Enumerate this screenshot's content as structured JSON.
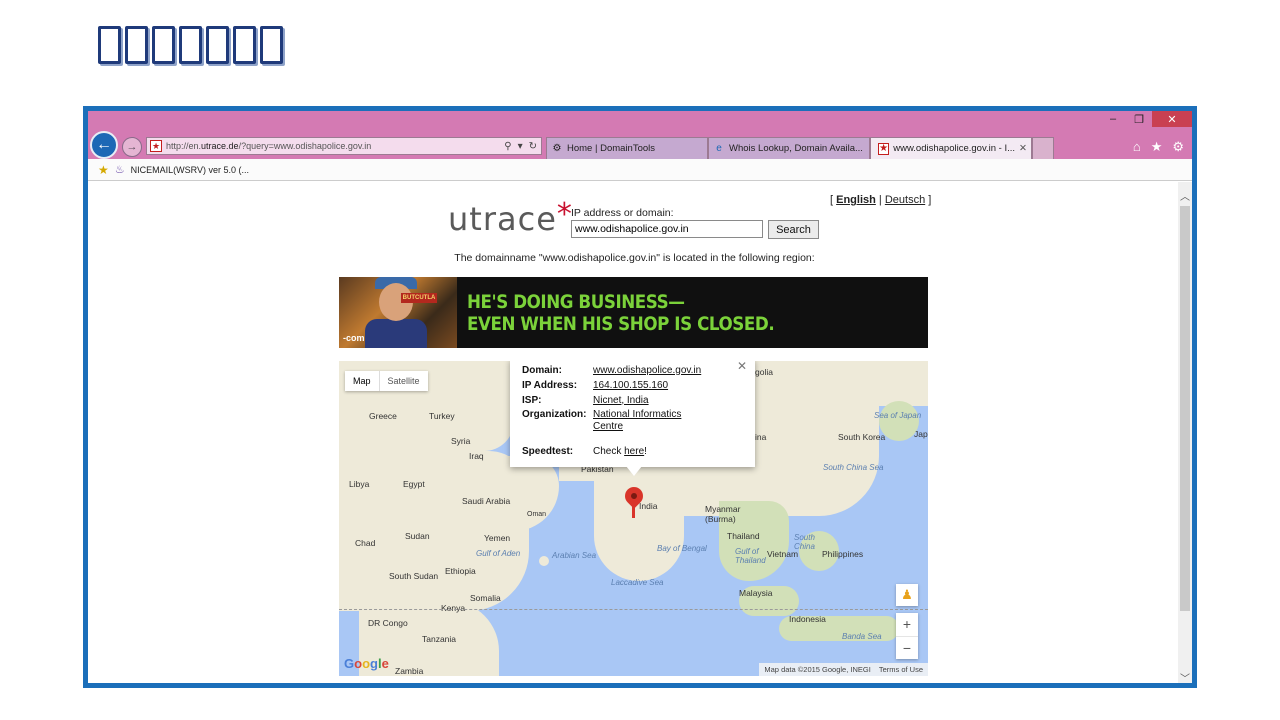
{
  "slide": {
    "title_boxes": 7
  },
  "browser": {
    "window_controls": {
      "minimize": "–",
      "restore": "❐",
      "close": "✕"
    },
    "address": {
      "url_prefix": "http://en.",
      "url_domain": "utrace.de",
      "url_suffix": "/?query=www.odishapolice.gov.in"
    },
    "tabs": [
      {
        "label": "Home | DomainTools",
        "icon": "domaintools-icon"
      },
      {
        "label": "Whois Lookup, Domain Availa...",
        "icon": "ie-icon"
      },
      {
        "label": "www.odishapolice.gov.in - I...",
        "icon": "utrace-favicon",
        "active": true
      }
    ],
    "favorites": [
      {
        "label": "NICEMAIL(WSRV) ver 5.0 (..."
      }
    ]
  },
  "page": {
    "lang": {
      "open": "[",
      "english": "English",
      "sep": "|",
      "deutsch": "Deutsch",
      "close": "]"
    },
    "logo": {
      "text": "utrace",
      "star": "*"
    },
    "search": {
      "label": "IP address or domain:",
      "value": "www.odishapolice.gov.in",
      "button": "Search"
    },
    "located_text": "The domainname \"www.odishapolice.gov.in\" is located in the following region:",
    "banner": {
      "line1": "HE'S DOING BUSINESS—",
      "line2": "EVEN WHEN HIS SHOP IS CLOSED.",
      "sign": "BUTCUTLA",
      "dotcom": "-com"
    },
    "map": {
      "type_buttons": {
        "map": "Map",
        "satellite": "Satellite"
      },
      "info": {
        "domain_label": "Domain:",
        "domain_value": "www.odishapolice.gov.in",
        "ip_label": "IP Address:",
        "ip_value": "164.100.155.160",
        "isp_label": "ISP:",
        "isp_value": "Nicnet, India",
        "org_label": "Organization:",
        "org_value_1": "National Informatics",
        "org_value_2": "Centre",
        "speed_label": "Speedtest:",
        "speed_prefix": "Check ",
        "speed_link": "here",
        "speed_suffix": "!"
      },
      "labels": {
        "greece": "Greece",
        "turkey": "Turkey",
        "syria": "Syria",
        "iraq": "Iraq",
        "libya": "Libya",
        "egypt": "Egypt",
        "saudi": "Saudi Arabia",
        "oman": "Oman",
        "chad": "Chad",
        "sudan": "Sudan",
        "yemen": "Yemen",
        "south_sudan": "South Sudan",
        "ethiopia": "Ethiopia",
        "somalia": "Somalia",
        "kenya": "Kenya",
        "dr_congo": "DR Congo",
        "tanzania": "Tanzania",
        "zambia": "Zambia",
        "pakistan": "Pakistan",
        "india": "India",
        "myanmar": "Myanmar\n(Burma)",
        "thailand": "Thailand",
        "vietnam": "Vietnam",
        "philippines": "Philippines",
        "malaysia": "Malaysia",
        "indonesia": "Indonesia",
        "south_korea": "South Korea",
        "japan": "Japa",
        "mongolia": "golia",
        "china": "ina"
      },
      "seas": {
        "gulf_aden": "Gulf of Aden",
        "arabian": "Arabian Sea",
        "bengal": "Bay of Bengal",
        "laccadive": "Laccadive Sea",
        "scs": "South China Sea",
        "japan_sea": "Sea of Japan",
        "south_china": "South\nChina",
        "thailand_gulf": "Gulf of\nThailand",
        "banda": "Banda Sea"
      },
      "zoom_in": "+",
      "zoom_out": "−",
      "attribution": "Map data ©2015 Google, INEGI",
      "terms": "Terms of Use"
    }
  }
}
